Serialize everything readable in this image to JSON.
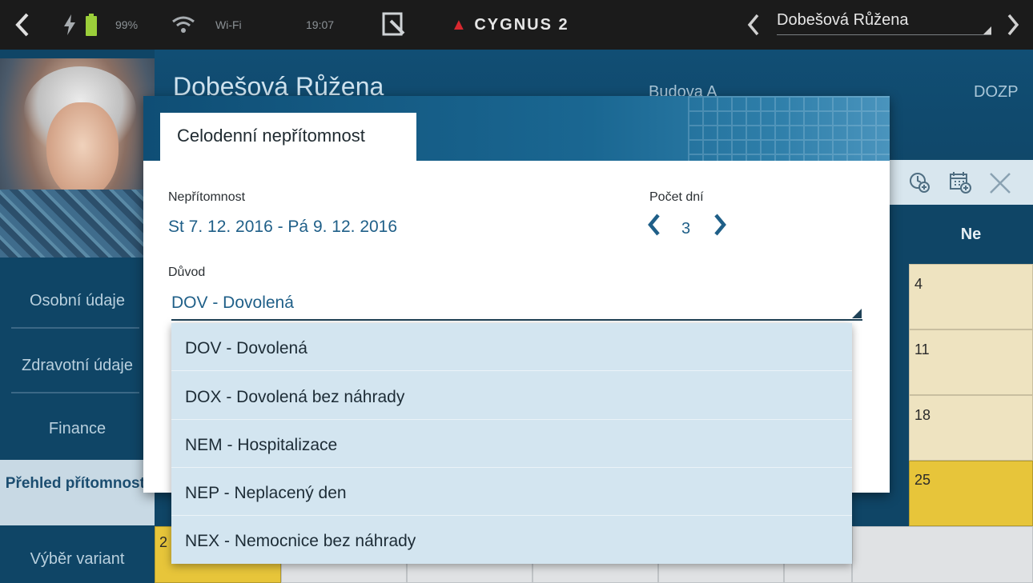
{
  "status_bar": {
    "battery": "99%",
    "wifi": "Wi-Fi",
    "time": "19:07",
    "brand": "CYGNUS 2",
    "patient_selector": "Dobešová Růžena"
  },
  "patient": {
    "name": "Dobešová Růžena",
    "building": "Budova A",
    "department": "DOZP"
  },
  "sidebar": {
    "items": [
      {
        "label": "Osobní údaje"
      },
      {
        "label": "Zdravotní údaje"
      },
      {
        "label": "Finance"
      },
      {
        "label": "Přehled přítomnosti"
      },
      {
        "label": "Výběr variant"
      }
    ]
  },
  "calendar": {
    "day_header": "Ne",
    "days": [
      "4",
      "11",
      "18",
      "25"
    ],
    "partial_day": "2"
  },
  "dialog": {
    "tab_title": "Celodenní nepřítomnost",
    "absence_label": "Nepřítomnost",
    "absence_value": "St 7. 12. 2016 - Pá 9. 12. 2016",
    "days_label": "Počet dní",
    "days_value": "3",
    "reason_label": "Důvod",
    "reason_value": "DOV - Dovolená"
  },
  "dropdown": {
    "options": [
      "DOV - Dovolená",
      "DOX - Dovolená bez náhrady",
      "NEM - Hospitalizace",
      "NEP - Neplacený den",
      "NEX - Nemocnice bez náhrady"
    ]
  },
  "colors": {
    "primary": "#0f4566",
    "accent_text": "#1f5f88",
    "highlight_yellow": "#e7c53a",
    "dropdown_bg": "#d3e5f0"
  }
}
